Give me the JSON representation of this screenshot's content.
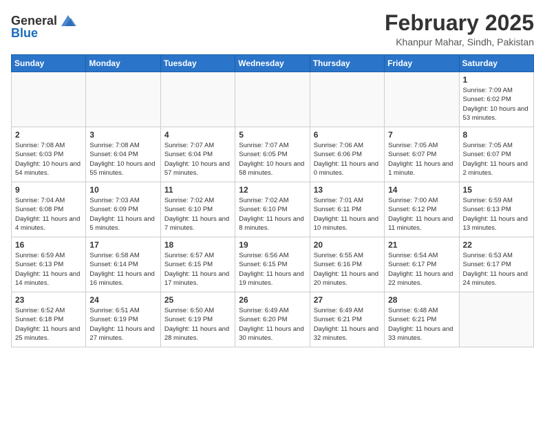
{
  "header": {
    "logo_general": "General",
    "logo_blue": "Blue",
    "month_year": "February 2025",
    "location": "Khanpur Mahar, Sindh, Pakistan"
  },
  "weekdays": [
    "Sunday",
    "Monday",
    "Tuesday",
    "Wednesday",
    "Thursday",
    "Friday",
    "Saturday"
  ],
  "weeks": [
    [
      {
        "day": "",
        "info": ""
      },
      {
        "day": "",
        "info": ""
      },
      {
        "day": "",
        "info": ""
      },
      {
        "day": "",
        "info": ""
      },
      {
        "day": "",
        "info": ""
      },
      {
        "day": "",
        "info": ""
      },
      {
        "day": "1",
        "info": "Sunrise: 7:09 AM\nSunset: 6:02 PM\nDaylight: 10 hours and 53 minutes."
      }
    ],
    [
      {
        "day": "2",
        "info": "Sunrise: 7:08 AM\nSunset: 6:03 PM\nDaylight: 10 hours and 54 minutes."
      },
      {
        "day": "3",
        "info": "Sunrise: 7:08 AM\nSunset: 6:04 PM\nDaylight: 10 hours and 55 minutes."
      },
      {
        "day": "4",
        "info": "Sunrise: 7:07 AM\nSunset: 6:04 PM\nDaylight: 10 hours and 57 minutes."
      },
      {
        "day": "5",
        "info": "Sunrise: 7:07 AM\nSunset: 6:05 PM\nDaylight: 10 hours and 58 minutes."
      },
      {
        "day": "6",
        "info": "Sunrise: 7:06 AM\nSunset: 6:06 PM\nDaylight: 11 hours and 0 minutes."
      },
      {
        "day": "7",
        "info": "Sunrise: 7:05 AM\nSunset: 6:07 PM\nDaylight: 11 hours and 1 minute."
      },
      {
        "day": "8",
        "info": "Sunrise: 7:05 AM\nSunset: 6:07 PM\nDaylight: 11 hours and 2 minutes."
      }
    ],
    [
      {
        "day": "9",
        "info": "Sunrise: 7:04 AM\nSunset: 6:08 PM\nDaylight: 11 hours and 4 minutes."
      },
      {
        "day": "10",
        "info": "Sunrise: 7:03 AM\nSunset: 6:09 PM\nDaylight: 11 hours and 5 minutes."
      },
      {
        "day": "11",
        "info": "Sunrise: 7:02 AM\nSunset: 6:10 PM\nDaylight: 11 hours and 7 minutes."
      },
      {
        "day": "12",
        "info": "Sunrise: 7:02 AM\nSunset: 6:10 PM\nDaylight: 11 hours and 8 minutes."
      },
      {
        "day": "13",
        "info": "Sunrise: 7:01 AM\nSunset: 6:11 PM\nDaylight: 11 hours and 10 minutes."
      },
      {
        "day": "14",
        "info": "Sunrise: 7:00 AM\nSunset: 6:12 PM\nDaylight: 11 hours and 11 minutes."
      },
      {
        "day": "15",
        "info": "Sunrise: 6:59 AM\nSunset: 6:13 PM\nDaylight: 11 hours and 13 minutes."
      }
    ],
    [
      {
        "day": "16",
        "info": "Sunrise: 6:59 AM\nSunset: 6:13 PM\nDaylight: 11 hours and 14 minutes."
      },
      {
        "day": "17",
        "info": "Sunrise: 6:58 AM\nSunset: 6:14 PM\nDaylight: 11 hours and 16 minutes."
      },
      {
        "day": "18",
        "info": "Sunrise: 6:57 AM\nSunset: 6:15 PM\nDaylight: 11 hours and 17 minutes."
      },
      {
        "day": "19",
        "info": "Sunrise: 6:56 AM\nSunset: 6:15 PM\nDaylight: 11 hours and 19 minutes."
      },
      {
        "day": "20",
        "info": "Sunrise: 6:55 AM\nSunset: 6:16 PM\nDaylight: 11 hours and 20 minutes."
      },
      {
        "day": "21",
        "info": "Sunrise: 6:54 AM\nSunset: 6:17 PM\nDaylight: 11 hours and 22 minutes."
      },
      {
        "day": "22",
        "info": "Sunrise: 6:53 AM\nSunset: 6:17 PM\nDaylight: 11 hours and 24 minutes."
      }
    ],
    [
      {
        "day": "23",
        "info": "Sunrise: 6:52 AM\nSunset: 6:18 PM\nDaylight: 11 hours and 25 minutes."
      },
      {
        "day": "24",
        "info": "Sunrise: 6:51 AM\nSunset: 6:19 PM\nDaylight: 11 hours and 27 minutes."
      },
      {
        "day": "25",
        "info": "Sunrise: 6:50 AM\nSunset: 6:19 PM\nDaylight: 11 hours and 28 minutes."
      },
      {
        "day": "26",
        "info": "Sunrise: 6:49 AM\nSunset: 6:20 PM\nDaylight: 11 hours and 30 minutes."
      },
      {
        "day": "27",
        "info": "Sunrise: 6:49 AM\nSunset: 6:21 PM\nDaylight: 11 hours and 32 minutes."
      },
      {
        "day": "28",
        "info": "Sunrise: 6:48 AM\nSunset: 6:21 PM\nDaylight: 11 hours and 33 minutes."
      },
      {
        "day": "",
        "info": ""
      }
    ]
  ]
}
